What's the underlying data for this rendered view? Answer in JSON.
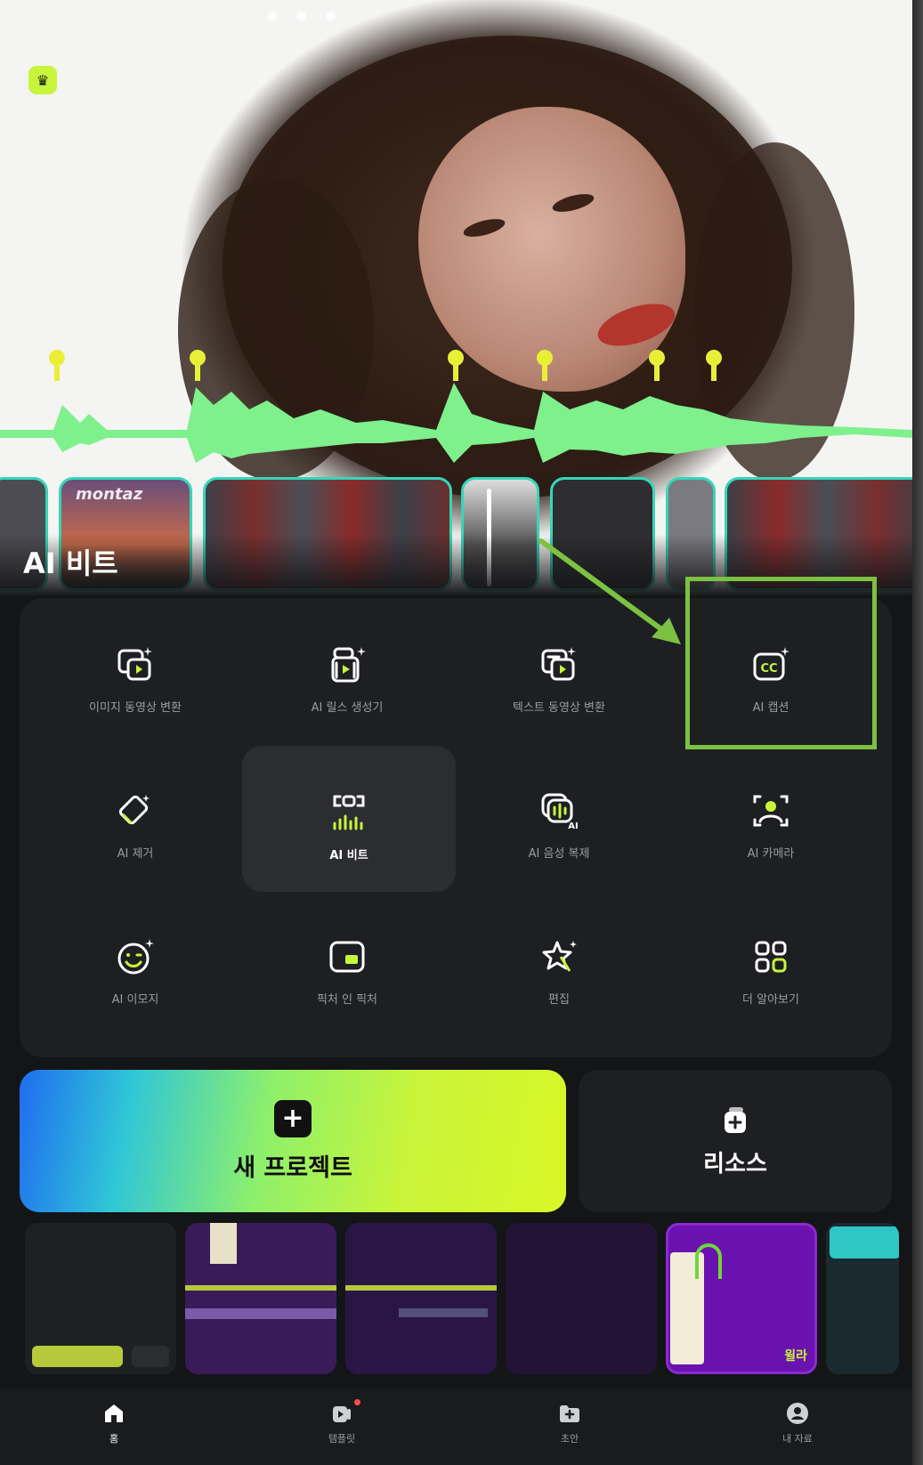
{
  "hero": {
    "title": "AI 비트",
    "badge_icon": "crown-icon",
    "thumb_text": "montaz"
  },
  "tools": [
    {
      "label": "이미지 동영상 변환",
      "icon": "image-to-video-icon"
    },
    {
      "label": "AI 릴스 생성기",
      "icon": "reels-generator-icon"
    },
    {
      "label": "텍스트 동영상 변환",
      "icon": "text-to-video-icon"
    },
    {
      "label": "AI 캡션",
      "icon": "cc-caption-icon"
    },
    {
      "label": "AI 제거",
      "icon": "eraser-icon"
    },
    {
      "label": "AI 비트",
      "icon": "beat-icon",
      "active": true
    },
    {
      "label": "AI 음성 복제",
      "icon": "voice-clone-icon"
    },
    {
      "label": "AI 카메라",
      "icon": "camera-person-icon"
    },
    {
      "label": "AI 이모지",
      "icon": "emoji-icon"
    },
    {
      "label": "픽처 인 픽처",
      "icon": "pip-icon"
    },
    {
      "label": "편집",
      "icon": "star-edit-icon"
    },
    {
      "label": "더 알아보기",
      "icon": "grid-more-icon"
    }
  ],
  "actions": {
    "new_project": "새 프로젝트",
    "resources": "리소스"
  },
  "recent_projects": [
    {
      "accent": "#1e2024"
    },
    {
      "accent": "#3a1b5a"
    },
    {
      "accent": "#2a1646"
    },
    {
      "accent": "#231436"
    },
    {
      "accent": "#6a12b0",
      "corner_text": "윌라"
    },
    {
      "accent": "#1b2a2f"
    }
  ],
  "nav": [
    {
      "label": "홈",
      "icon": "home-icon",
      "active": true
    },
    {
      "label": "템플릿",
      "icon": "template-icon"
    },
    {
      "label": "초안",
      "icon": "draft-folder-icon"
    },
    {
      "label": "내 자료",
      "icon": "profile-icon"
    }
  ],
  "colors": {
    "accent": "#c7f53a",
    "highlight_annotation": "#7cc142",
    "thumb_border": "#35d6b8",
    "panel_bg": "#1e1f22"
  }
}
